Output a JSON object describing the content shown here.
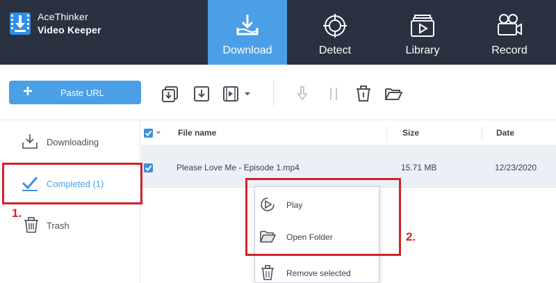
{
  "app": {
    "name_line1": "AceThinker",
    "name_line2": "Video Keeper",
    "accent": "#4a9fe6",
    "header_bg": "#2a3140"
  },
  "nav": [
    {
      "label": "Download",
      "icon": "download-tray-icon",
      "active": true
    },
    {
      "label": "Detect",
      "icon": "target-icon",
      "active": false
    },
    {
      "label": "Library",
      "icon": "library-play-icon",
      "active": false
    },
    {
      "label": "Record",
      "icon": "video-camera-icon",
      "active": false
    }
  ],
  "toolbar": {
    "paste_label": "Paste URL",
    "icons": [
      "download-multiple-icon",
      "download-icon",
      "video-format-icon",
      "resume-download-icon",
      "pause-icon",
      "delete-icon",
      "open-folder-icon"
    ]
  },
  "sidebar": [
    {
      "label": "Downloading",
      "icon": "download-tray-icon"
    },
    {
      "label": "Completed (1)",
      "icon": "checkmark-icon",
      "active": true
    },
    {
      "label": "Trash",
      "icon": "trash-icon"
    }
  ],
  "table": {
    "columns": [
      "File name",
      "Size",
      "Date"
    ],
    "rows": [
      {
        "name": "Please Love Me - Episode 1.mp4",
        "size": "15.71 MB",
        "date": "12/23/2020",
        "checked": true
      }
    ]
  },
  "context_menu": [
    {
      "label": "Play",
      "icon": "play-icon"
    },
    {
      "label": "Open Folder",
      "icon": "folder-icon"
    },
    {
      "label": "Remove selected",
      "icon": "trash-icon"
    }
  ],
  "annotations": {
    "step1": "1.",
    "step2": "2.",
    "color": "#d32027"
  }
}
